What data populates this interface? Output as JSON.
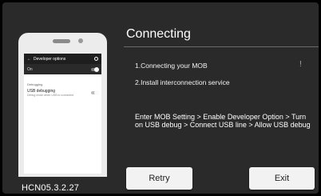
{
  "dialog": {
    "title": "Connecting",
    "steps": [
      "1.Connecting your MOB",
      "2.Install interconnection service"
    ],
    "status_mark": "!",
    "instructions": "Enter MOB Setting > Enable Developer Option > Turn on USB debug > Connect USB line > Allow USB debug",
    "buttons": {
      "retry": "Retry",
      "exit": "Exit"
    },
    "version": "HCN05.3.2.27"
  },
  "phone_illustration": {
    "appbar_title": "Developer options",
    "on_label": "On",
    "section_label": "Debugging",
    "setting_title": "USB debugging",
    "setting_subtitle": "Debug mode when USB is connected"
  },
  "colors": {
    "background": "#2a2a2a",
    "button": "#f2f2f2",
    "text": "#ffffff"
  }
}
